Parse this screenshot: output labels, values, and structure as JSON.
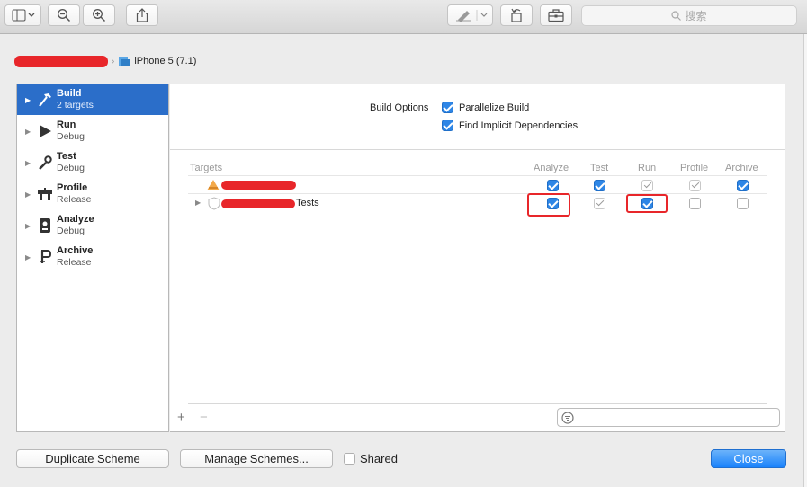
{
  "toolbar": {
    "search_placeholder": "搜索",
    "icons": [
      "sidebar-toggle-icon",
      "zoom-out-icon",
      "zoom-in-icon",
      "share-icon",
      "pen-icon",
      "rotate-icon",
      "toolbox-icon"
    ]
  },
  "scheme": {
    "destination": "iPhone 5 (7.1)"
  },
  "sidebar": {
    "items": [
      {
        "title": "Build",
        "subtitle": "2 targets",
        "icon": "hammer-icon",
        "selected": true
      },
      {
        "title": "Run",
        "subtitle": "Debug",
        "icon": "play-icon"
      },
      {
        "title": "Test",
        "subtitle": "Debug",
        "icon": "wrench-icon"
      },
      {
        "title": "Profile",
        "subtitle": "Release",
        "icon": "instruments-icon"
      },
      {
        "title": "Analyze",
        "subtitle": "Debug",
        "icon": "analyze-icon"
      },
      {
        "title": "Archive",
        "subtitle": "Release",
        "icon": "archive-icon"
      }
    ]
  },
  "build_options": {
    "label": "Build Options",
    "options": [
      {
        "label": "Parallelize Build",
        "checked": true
      },
      {
        "label": "Find Implicit Dependencies",
        "checked": true
      }
    ]
  },
  "targets_table": {
    "columns": [
      "Targets",
      "Analyze",
      "Test",
      "Run",
      "Profile",
      "Archive"
    ],
    "rows": [
      {
        "name_suffix": "",
        "checks": [
          "on",
          "on",
          "gray",
          "gray",
          "on"
        ]
      },
      {
        "name_suffix": "Tests",
        "checks": [
          "on",
          "gray",
          "on",
          "off",
          "off"
        ]
      }
    ]
  },
  "footer": {
    "add_label": "+",
    "remove_label": "−"
  },
  "buttons": {
    "duplicate": "Duplicate Scheme",
    "manage": "Manage Schemes...",
    "shared": "Shared",
    "close": "Close"
  },
  "colors": {
    "accent": "#2b6ec9",
    "checkbox": "#2e86e6",
    "annotation": "#e8262a"
  }
}
